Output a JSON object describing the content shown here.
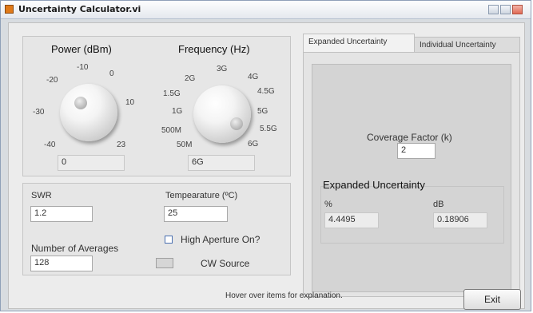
{
  "window": {
    "title": "Uncertainty Calculator.vi"
  },
  "power": {
    "label": "Power (dBm)",
    "ticks": [
      "-10",
      "0",
      "-20",
      "10",
      "-30",
      "-40",
      "23"
    ],
    "value": "0"
  },
  "frequency": {
    "label": "Frequency (Hz)",
    "ticks": [
      "3G",
      "2G",
      "4G",
      "1.5G",
      "4.5G",
      "1G",
      "5G",
      "500M",
      "5.5G",
      "50M",
      "6G"
    ],
    "value": "6G"
  },
  "swr": {
    "label": "SWR",
    "value": "1.2"
  },
  "temperature": {
    "label": "Tempearature (ºC)",
    "value": "25"
  },
  "averages": {
    "label": "Number of Averages",
    "value": "128"
  },
  "high_aperture": {
    "label": "High Aperture On?"
  },
  "cw_source": {
    "label": "CW Source"
  },
  "tabs": [
    {
      "label": "Expanded Uncertainty"
    },
    {
      "label": "Individual Uncertainty"
    }
  ],
  "coverage": {
    "label": "Coverage Factor (k)",
    "value": "2"
  },
  "expanded": {
    "title": "Expanded Uncertainty",
    "percent_label": "%",
    "percent_value": "4.4495",
    "db_label": "dB",
    "db_value": "0.18906"
  },
  "status": "Hover over items for explanation.",
  "exit_label": "Exit",
  "colors": {
    "window_border": "#8fa0b8",
    "checkbox_border": "#4a6fb0"
  }
}
